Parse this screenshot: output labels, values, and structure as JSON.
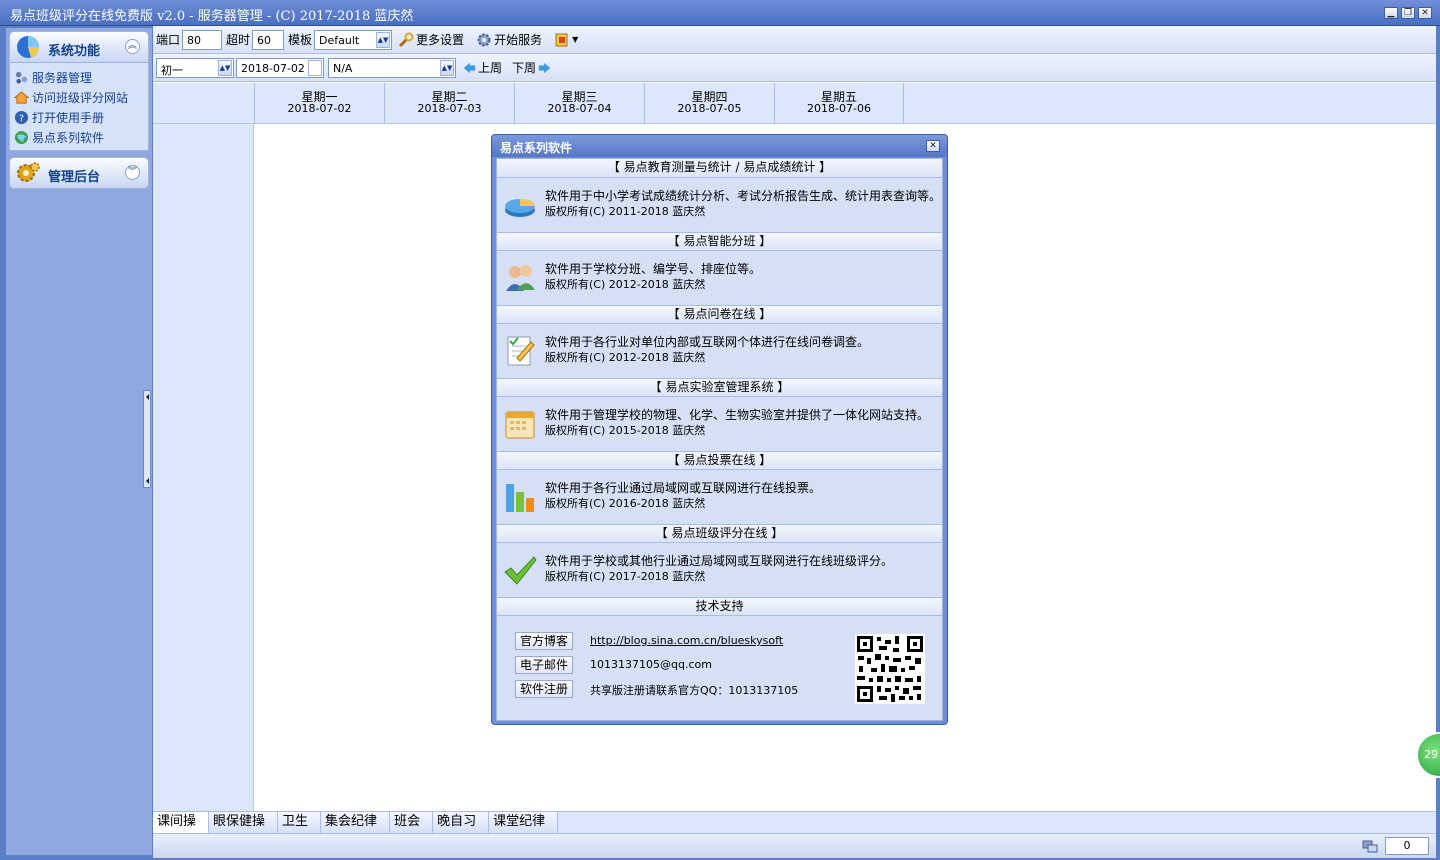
{
  "window": {
    "title": "易点班级评分在线免费版 v2.0 - 服务器管理 - (C) 2017-2018 蓝庆然",
    "controls": {
      "minimize": "▁",
      "restore": "❐",
      "close": "✕"
    }
  },
  "sidebar": {
    "panel1_title": "系统功能",
    "panel1_items": [
      {
        "label": "服务器管理",
        "icon": "server-icon"
      },
      {
        "label": "访问班级评分网站",
        "icon": "home-icon"
      },
      {
        "label": "打开使用手册",
        "icon": "help-icon"
      },
      {
        "label": "易点系列软件",
        "icon": "globe-icon"
      }
    ],
    "panel2_title": "管理后台",
    "collapse_glyph": "︽",
    "expand_glyph": "︾"
  },
  "toolbar1": {
    "port_label": "端口",
    "port_value": "80",
    "timeout_label": "超时",
    "timeout_value": "60",
    "template_label": "模板",
    "template_value": "Default",
    "more_settings_label": "更多设置",
    "start_service_label": "开始服务"
  },
  "toolbar2": {
    "grade_value": "初一",
    "date_value": "2018-07-02",
    "class_value": "N/A",
    "prev_week_label": "上周",
    "next_week_label": "下周"
  },
  "schedule": {
    "days": [
      {
        "name": "星期一",
        "date": "2018-07-02"
      },
      {
        "name": "星期二",
        "date": "2018-07-03"
      },
      {
        "name": "星期三",
        "date": "2018-07-04"
      },
      {
        "name": "星期四",
        "date": "2018-07-05"
      },
      {
        "name": "星期五",
        "date": "2018-07-06"
      }
    ]
  },
  "tabs": [
    "课间操",
    "眼保健操",
    "卫生",
    "集会纪律",
    "班会",
    "晚自习",
    "课堂纪律"
  ],
  "status": {
    "count": "0",
    "badge": "29"
  },
  "dialog": {
    "title": "易点系列软件",
    "close": "✕",
    "products": [
      {
        "heading": "【 易点教育测量与统计 / 易点成绩统计 】",
        "desc": "软件用于中小学考试成绩统计分析、考试分析报告生成、统计用表查询等。",
        "copyright": "版权所有(C)  2011-2018  蓝庆然",
        "icon": "pie-chart-icon"
      },
      {
        "heading": "【 易点智能分班 】",
        "desc": "软件用于学校分班、编学号、排座位等。",
        "copyright": "版权所有(C)  2012-2018  蓝庆然",
        "icon": "users-icon"
      },
      {
        "heading": "【 易点问卷在线 】",
        "desc": "软件用于各行业对单位内部或互联网个体进行在线问卷调查。",
        "copyright": "版权所有(C)  2012-2018  蓝庆然",
        "icon": "notepad-icon"
      },
      {
        "heading": "【 易点实验室管理系统 】",
        "desc": "软件用于管理学校的物理、化学、生物实验室并提供了一体化网站支持。",
        "copyright": "版权所有(C)  2015-2018  蓝庆然",
        "icon": "calendar-icon"
      },
      {
        "heading": "【 易点投票在线 】",
        "desc": "软件用于各行业通过局域网或互联网进行在线投票。",
        "copyright": "版权所有(C)  2016-2018  蓝庆然",
        "icon": "bar-chart-icon"
      },
      {
        "heading": "【 易点班级评分在线 】",
        "desc": "软件用于学校或其他行业通过局域网或互联网进行在线班级评分。",
        "copyright": "版权所有(C)  2017-2018  蓝庆然",
        "icon": "checkmark-icon"
      }
    ],
    "support": {
      "heading": "技术支持",
      "blog_label": "官方博客",
      "blog_value": "http://blog.sina.com.cn/blueskysoft",
      "email_label": "电子邮件",
      "email_value": "1013137105@qq.com",
      "register_label": "软件注册",
      "register_value": "共享版注册请联系官方QQ：1013137105"
    }
  }
}
